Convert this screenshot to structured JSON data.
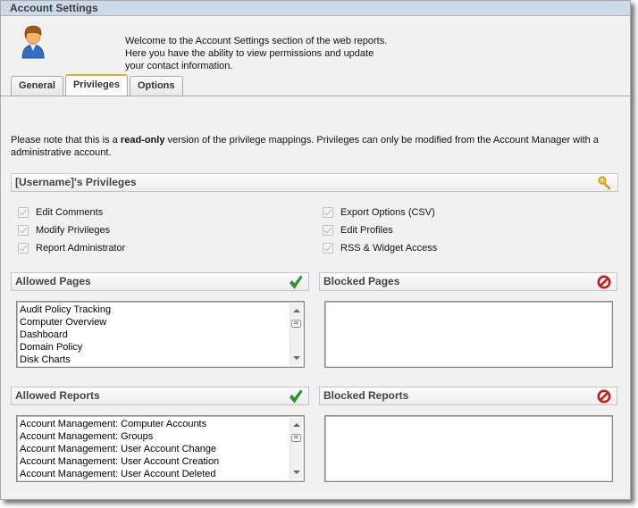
{
  "window": {
    "title": "Account Settings"
  },
  "header": {
    "avatar_icon": "user-avatar-icon",
    "welcome_lines": [
      "Welcome to the Account Settings section of the web reports.",
      "Here you have the ability to view permissions and update",
      "your contact information."
    ]
  },
  "tabs": [
    {
      "label": "General",
      "active": false
    },
    {
      "label": "Privileges",
      "active": true
    },
    {
      "label": "Options",
      "active": false
    }
  ],
  "note": {
    "prefix": "Please note that this is a ",
    "bold": "read-only",
    "suffix": " version of the privilege mappings. Privileges can only be modified from the Account Manager with a administrative account."
  },
  "privileges": {
    "title": "[Username]'s Privileges",
    "icon": "key-icon",
    "left": [
      {
        "label": "Edit Comments",
        "checked": true
      },
      {
        "label": "Modify Privileges",
        "checked": true
      },
      {
        "label": "Report Administrator",
        "checked": true
      }
    ],
    "right": [
      {
        "label": "Export Options (CSV)",
        "checked": true
      },
      {
        "label": "Edit Profiles",
        "checked": true
      },
      {
        "label": "RSS & Widget Access",
        "checked": true
      }
    ]
  },
  "allowed_pages": {
    "title": "Allowed Pages",
    "icon": "checkmark-icon",
    "items": [
      "Audit Policy Tracking",
      "Computer Overview",
      "Dashboard",
      "Domain Policy",
      "Disk Charts"
    ]
  },
  "blocked_pages": {
    "title": "Blocked Pages",
    "icon": "blocked-icon",
    "items": []
  },
  "allowed_reports": {
    "title": "Allowed Reports",
    "icon": "checkmark-icon",
    "items": [
      "Account Management: Computer Accounts",
      "Account Management: Groups",
      "Account Management: User Account Change",
      "Account Management: User Account Creation",
      "Account Management: User Account Deleted"
    ]
  },
  "blocked_reports": {
    "title": "Blocked Reports",
    "icon": "blocked-icon",
    "items": []
  },
  "colors": {
    "titlebar": "#cbd9e8",
    "active_tab_accent": "#f5a623",
    "check_green": "#2a9d2a",
    "block_red": "#c0201c"
  }
}
